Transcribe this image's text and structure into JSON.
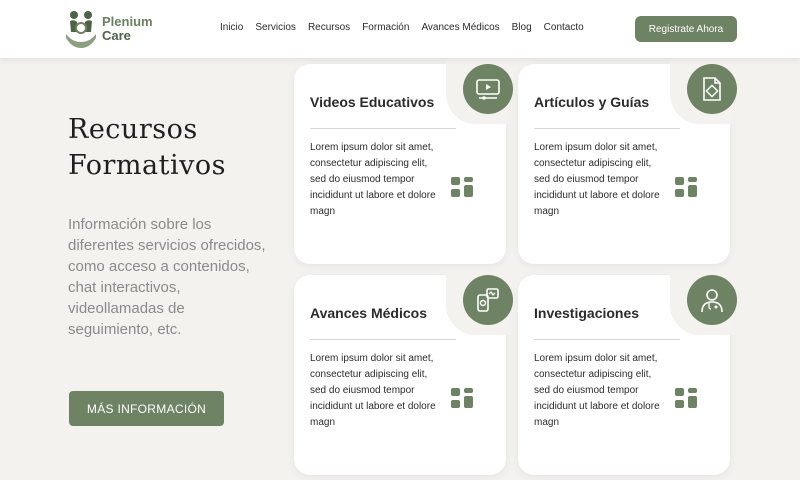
{
  "brand": {
    "name_line1": "Plenium",
    "name_line2": "Care",
    "accent": "#6e8264"
  },
  "nav": {
    "items": [
      "Inicio",
      "Servicios",
      "Recursos",
      "Formación",
      "Avances Médicos",
      "Blog",
      "Contacto"
    ],
    "cta": "Registrate Ahora"
  },
  "hero": {
    "title_line1": "Recursos",
    "title_line2": "Formativos",
    "description": "Información sobre los diferentes servicios ofrecidos, como acceso a contenidos, chat interactivos, videollamadas de seguimiento, etc.",
    "button": "MÁS INFORMACIÓN"
  },
  "cards": [
    {
      "title": "Videos Educativos",
      "icon": "video-icon",
      "body": "Lorem ipsum dolor sit amet, consectetur adipiscing elit, sed do eiusmod tempor incididunt ut labore et dolore magn"
    },
    {
      "title": "Artículos y Guías",
      "icon": "document-icon",
      "body": "Lorem ipsum dolor sit amet, consectetur adipiscing elit, sed do eiusmod tempor incididunt ut labore et dolore magn"
    },
    {
      "title": "Avances Médicos",
      "icon": "medical-device-icon",
      "body": "Lorem ipsum dolor sit amet, consectetur adipiscing elit, sed do eiusmod tempor incididunt ut labore et dolore magn"
    },
    {
      "title": "Investigaciones",
      "icon": "doctor-icon",
      "body": "Lorem ipsum dolor sit amet, consectetur adipiscing elit, sed do eiusmod tempor incididunt ut labore et dolore magn"
    }
  ]
}
